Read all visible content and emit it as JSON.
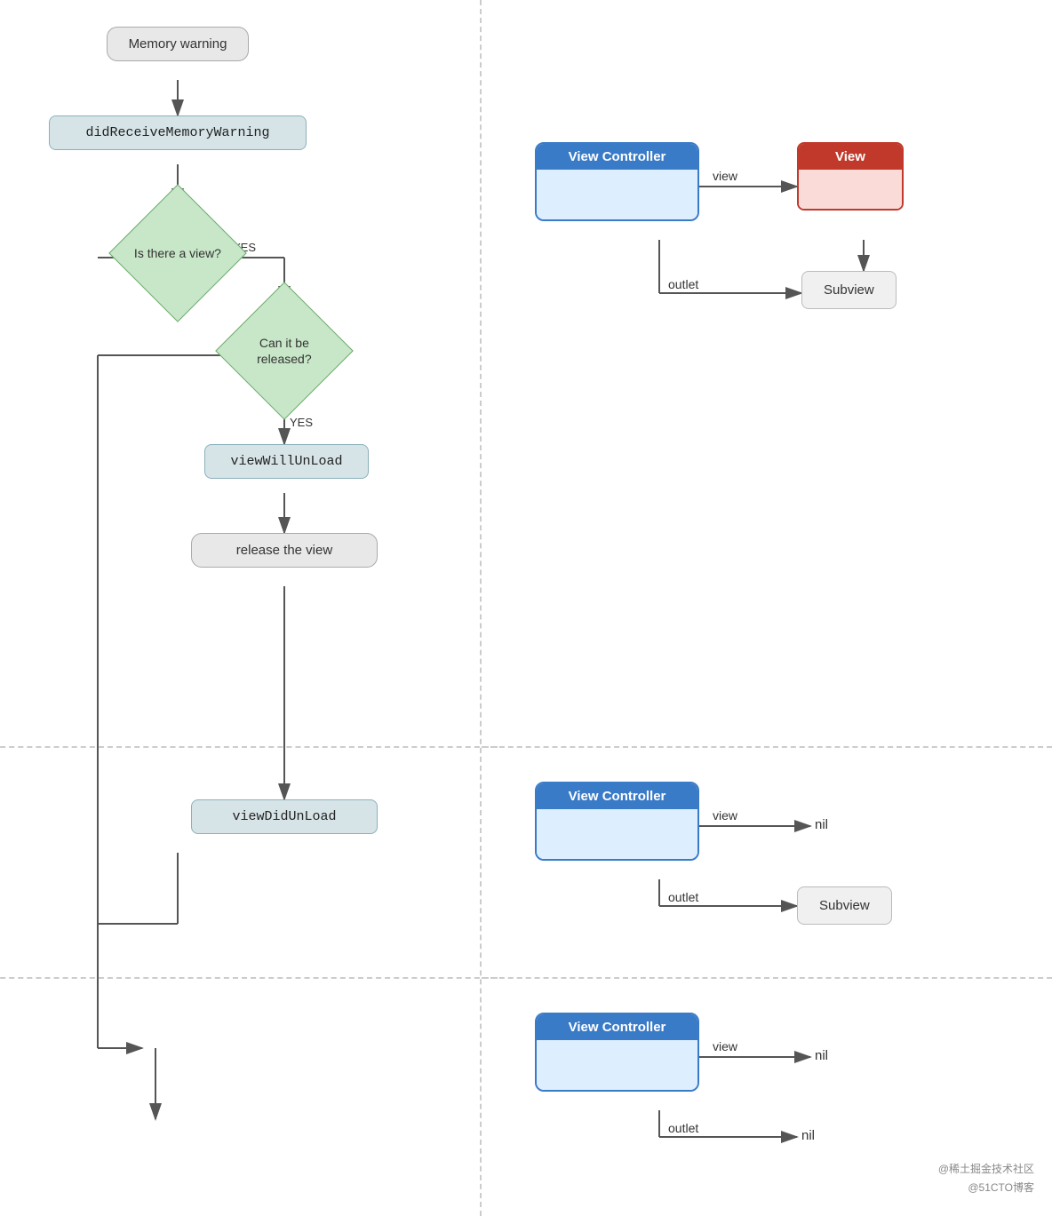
{
  "flowchart": {
    "memory_warning": "Memory warning",
    "did_receive": "didReceiveMemoryWarning",
    "is_there_view": "Is there\na view?",
    "yes1": "YES",
    "can_be_released": "Can it be\nreleased?",
    "yes2": "YES",
    "view_will_unload": "viewWillUnLoad",
    "release_view": "release the view",
    "view_did_unload": "viewDidUnLoad"
  },
  "diagram1": {
    "vc_label": "View Controller",
    "view_label": "View",
    "view_arrow": "view",
    "outlet_arrow": "outlet",
    "subview_label": "Subview"
  },
  "diagram2": {
    "vc_label": "View Controller",
    "view_arrow": "view",
    "view_value": "nil",
    "outlet_arrow": "outlet",
    "subview_label": "Subview"
  },
  "diagram3": {
    "vc_label": "View Controller",
    "view_arrow": "view",
    "view_value": "nil",
    "outlet_arrow": "outlet",
    "outlet_value": "nil"
  },
  "watermark": {
    "line1": "@稀土掘金技术社区",
    "line2": "@51CTO博客"
  }
}
